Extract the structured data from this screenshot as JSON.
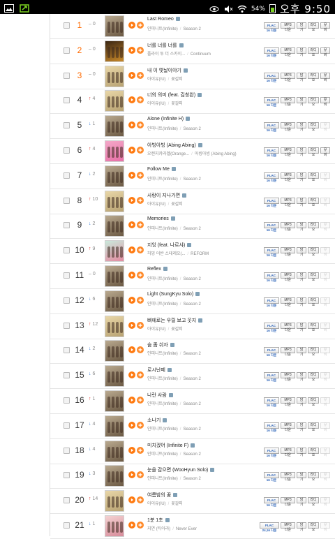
{
  "statusbar": {
    "battery_pct": "54%",
    "clock": "오후 9:50"
  },
  "colors": {
    "accent": "#ff7a10",
    "up": "#e8352b",
    "down": "#3f7fd8",
    "hot_rank": "#ff6a00"
  },
  "buttons": {
    "flac": "FLAC 16",
    "flac24": "FLAC 24,16",
    "dl": "다운",
    "mp3": "MP3",
    "get": "담기",
    "ring": "라디오",
    "video": "뮤비"
  },
  "rows": [
    {
      "rank": "1",
      "dir": "same",
      "chg": "0",
      "title": "Last Romeo",
      "artist": "인피니트(Infinite)",
      "album": "Season 2",
      "hot": true,
      "mv": true,
      "flac": "FLAC 16",
      "art": [
        "#b9a98f",
        "#6c5a44"
      ]
    },
    {
      "rank": "2",
      "dir": "same",
      "chg": "0",
      "title": "너를 너를 너를",
      "artist": "플라이 투 더 스카이...",
      "album": "Continuum",
      "hot": true,
      "mv": true,
      "flac": "FLAC 16",
      "art": [
        "#3a2614",
        "#c98a2a"
      ]
    },
    {
      "rank": "3",
      "dir": "same",
      "chg": "0",
      "title": "내 이 옛날이야기",
      "artist": "아이유(IU)",
      "album": "꽃갈피",
      "hot": true,
      "mv": true,
      "flac": "FLAC 16",
      "art": [
        "#e9d7a8",
        "#b8a272"
      ]
    },
    {
      "rank": "4",
      "dir": "up",
      "chg": "4",
      "title": "너의 의미 (feat. 김창완)",
      "artist": "아이유(IU)",
      "album": "꽃갈피",
      "hot": false,
      "mv": true,
      "flac": "FLAC 16",
      "art": [
        "#e9d7a8",
        "#b8a272"
      ]
    },
    {
      "rank": "5",
      "dir": "down",
      "chg": "1",
      "title": "Alone (Infinite H)",
      "artist": "인피니트(Infinite)",
      "album": "Season 2",
      "hot": false,
      "mv": false,
      "flac": "FLAC 16",
      "art": [
        "#b9a98f",
        "#6c5a44"
      ]
    },
    {
      "rank": "6",
      "dir": "up",
      "chg": "4",
      "title": "아빙아빙 (Abing Abing)",
      "artist": "오렌지캬라멜(Orange...",
      "album": "아빙아빙 (Abing Abing)",
      "hot": false,
      "mv": true,
      "flac": "FLAC 16",
      "art": [
        "#f3a8c8",
        "#e86fa6"
      ]
    },
    {
      "rank": "7",
      "dir": "down",
      "chg": "2",
      "title": "Follow Me",
      "artist": "인피니트(Infinite)",
      "album": "Season 2",
      "hot": false,
      "mv": false,
      "flac": "FLAC 16",
      "art": [
        "#b9a98f",
        "#6c5a44"
      ]
    },
    {
      "rank": "8",
      "dir": "up",
      "chg": "10",
      "title": "사랑이 지나가면",
      "artist": "아이유(IU)",
      "album": "꽃갈피",
      "hot": false,
      "mv": false,
      "flac": "FLAC 16",
      "art": [
        "#e9d7a8",
        "#b8a272"
      ]
    },
    {
      "rank": "9",
      "dir": "down",
      "chg": "2",
      "title": "Memories",
      "artist": "인피니트(Infinite)",
      "album": "Season 2",
      "hot": false,
      "mv": false,
      "flac": "FLAC 16",
      "art": [
        "#b9a98f",
        "#6c5a44"
      ]
    },
    {
      "rank": "10",
      "dir": "up",
      "chg": "9",
      "title": "지잉 (feat. 나르샤)",
      "artist": "허밍 어반 스테레오(...",
      "album": "REFORM",
      "hot": false,
      "mv": false,
      "flac": "FLAC 16",
      "art": [
        "#c9eadc",
        "#e38aa0"
      ]
    },
    {
      "rank": "11",
      "dir": "same",
      "chg": "0",
      "title": "Reflex",
      "artist": "인피니트(Infinite)",
      "album": "Season 2",
      "hot": false,
      "mv": false,
      "flac": "FLAC 16",
      "art": [
        "#b9a98f",
        "#6c5a44"
      ]
    },
    {
      "rank": "12",
      "dir": "down",
      "chg": "6",
      "title": "Light (SungKyu Solo)",
      "artist": "인피니트(Infinite)",
      "album": "Season 2",
      "hot": false,
      "mv": false,
      "flac": "FLAC 16",
      "art": [
        "#b9a98f",
        "#6c5a44"
      ]
    },
    {
      "rank": "13",
      "dir": "up",
      "chg": "12",
      "title": "삐에로는 우릴 보고 웃지",
      "artist": "아이유(IU)",
      "album": "꽃갈피",
      "hot": false,
      "mv": false,
      "flac": "FLAC 16",
      "art": [
        "#e9d7a8",
        "#b8a272"
      ]
    },
    {
      "rank": "14",
      "dir": "down",
      "chg": "2",
      "title": "숨 좀 쉬자",
      "artist": "인피니트(Infinite)",
      "album": "Season 2",
      "hot": false,
      "mv": false,
      "flac": "FLAC 16",
      "art": [
        "#b9a98f",
        "#6c5a44"
      ]
    },
    {
      "rank": "15",
      "dir": "down",
      "chg": "6",
      "title": "로시난떼",
      "artist": "인피니트(Infinite)",
      "album": "Season 2",
      "hot": false,
      "mv": false,
      "flac": "FLAC 16",
      "art": [
        "#b9a98f",
        "#6c5a44"
      ]
    },
    {
      "rank": "16",
      "dir": "up",
      "chg": "1",
      "title": "나란 사람",
      "artist": "인피니트(Infinite)",
      "album": "Season 2",
      "hot": false,
      "mv": false,
      "flac": "FLAC 16",
      "art": [
        "#b9a98f",
        "#6c5a44"
      ]
    },
    {
      "rank": "17",
      "dir": "down",
      "chg": "4",
      "title": "소나기",
      "artist": "인피니트(Infinite)",
      "album": "Season 2",
      "hot": false,
      "mv": false,
      "flac": "FLAC 16",
      "art": [
        "#b9a98f",
        "#6c5a44"
      ]
    },
    {
      "rank": "18",
      "dir": "down",
      "chg": "4",
      "title": "미치겠어 (Infinite F)",
      "artist": "인피니트(Infinite)",
      "album": "Season 2",
      "hot": false,
      "mv": false,
      "flac": "FLAC 16",
      "art": [
        "#b9a98f",
        "#6c5a44"
      ]
    },
    {
      "rank": "19",
      "dir": "down",
      "chg": "3",
      "title": "눈을 감으면 (WooHyun Solo)",
      "artist": "인피니트(Infinite)",
      "album": "Season 2",
      "hot": false,
      "mv": false,
      "flac": "FLAC 16",
      "art": [
        "#b9a98f",
        "#6c5a44"
      ]
    },
    {
      "rank": "20",
      "dir": "up",
      "chg": "14",
      "title": "여름밤의 꿈",
      "artist": "아이유(IU)",
      "album": "꽃갈피",
      "hot": false,
      "mv": false,
      "flac": "FLAC 16",
      "art": [
        "#e9d7a8",
        "#b8a272"
      ]
    },
    {
      "rank": "21",
      "dir": "down",
      "chg": "1",
      "title": "1분 1초",
      "artist": "지연 (티아라)",
      "album": "Never Ever",
      "hot": false,
      "mv": false,
      "flac": "FLAC 24,16",
      "art": [
        "#f4d2d2",
        "#d78b9a"
      ]
    }
  ]
}
